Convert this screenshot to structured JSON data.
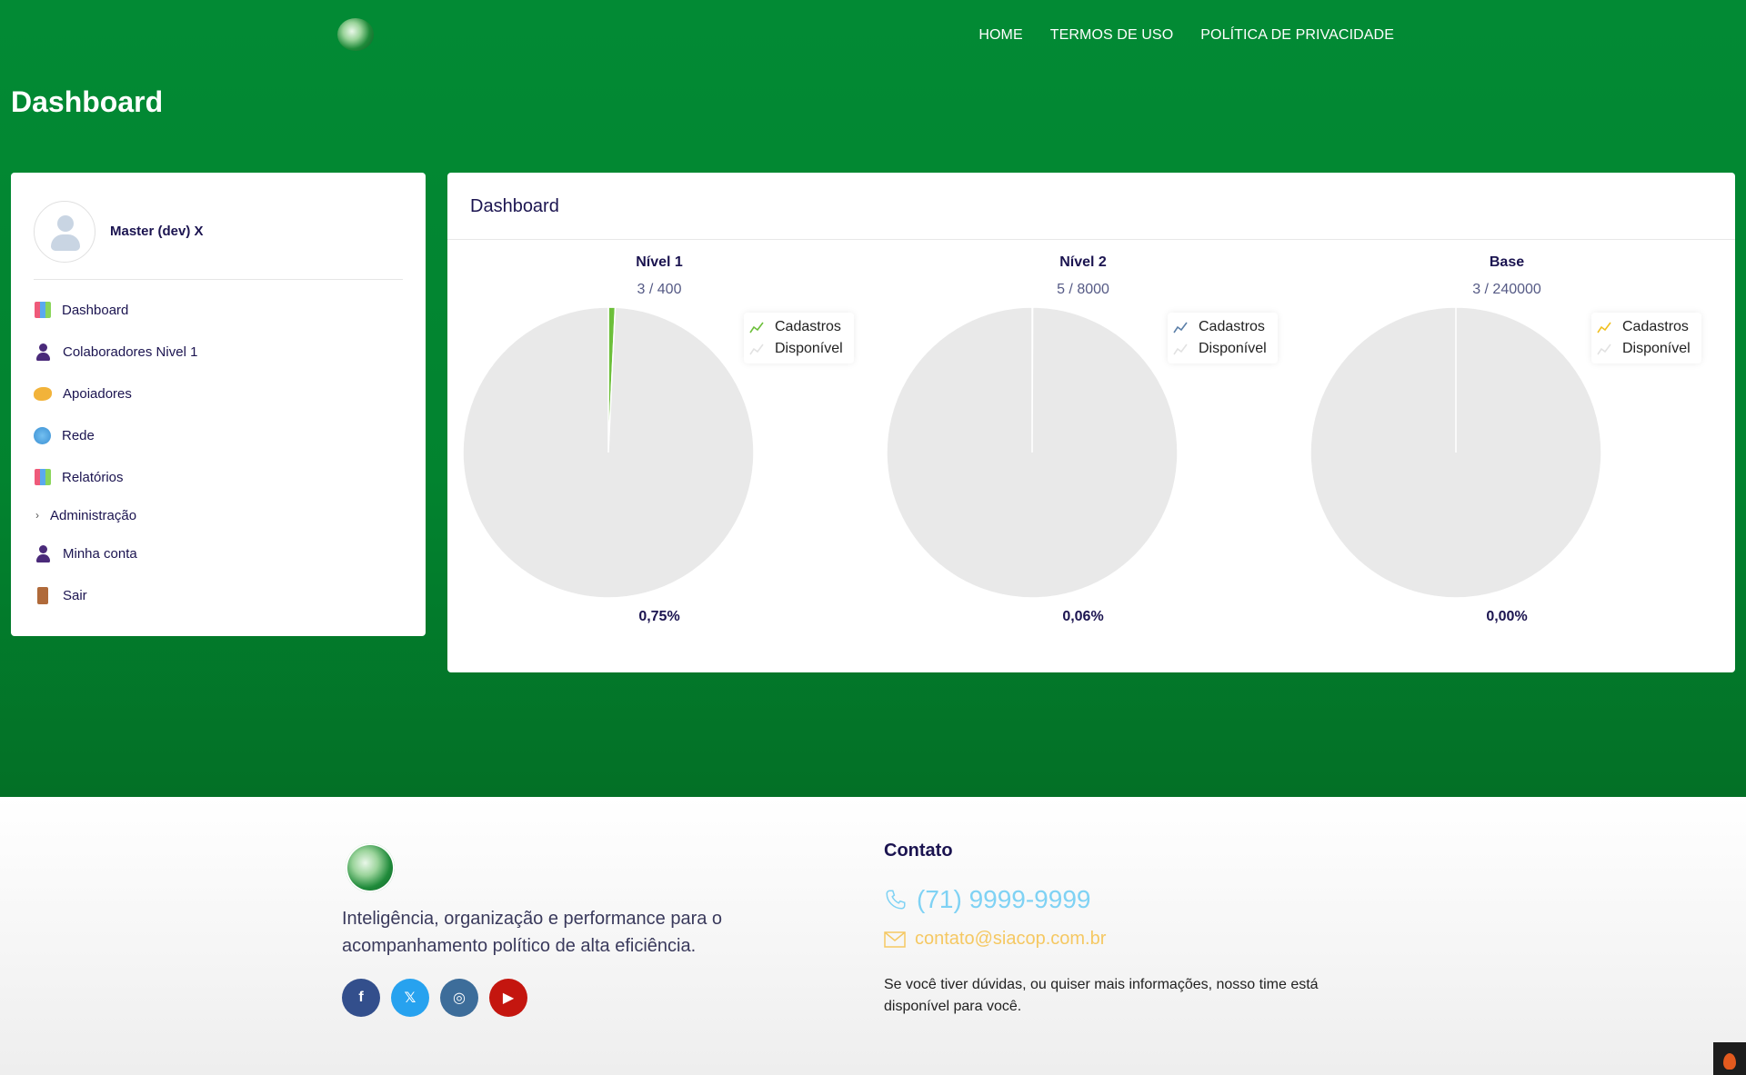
{
  "nav": {
    "items": [
      "HOME",
      "TERMOS DE USO",
      "POLÍTICA DE PRIVACIDADE"
    ]
  },
  "page_title": "Dashboard",
  "sidebar": {
    "user_name": "Master (dev) X",
    "items": [
      {
        "label": "Dashboard",
        "icon": "bar-chart-icon"
      },
      {
        "label": "Colaboradores Nivel 1",
        "icon": "user-icon"
      },
      {
        "label": "Apoiadores",
        "icon": "handshake-icon"
      },
      {
        "label": "Rede",
        "icon": "globe-icon"
      },
      {
        "label": "Relatórios",
        "icon": "bar-chart-icon"
      },
      {
        "label": "Administração",
        "icon": "chevron-right-icon"
      },
      {
        "label": "Minha conta",
        "icon": "user-icon"
      },
      {
        "label": "Sair",
        "icon": "door-icon"
      }
    ]
  },
  "main": {
    "title": "Dashboard"
  },
  "chart_data": [
    {
      "type": "pie",
      "title": "Nível 1",
      "subtitle": "3 / 400",
      "categories": [
        "Cadastros",
        "Disponível"
      ],
      "values": [
        3,
        397
      ],
      "percent_label": "0,75%",
      "colors": [
        "#6cbf3a",
        "#e9e9e9"
      ],
      "legend": "top-right"
    },
    {
      "type": "pie",
      "title": "Nível 2",
      "subtitle": "5 / 8000",
      "categories": [
        "Cadastros",
        "Disponível"
      ],
      "values": [
        5,
        7995
      ],
      "percent_label": "0,06%",
      "colors": [
        "#5b7fa8",
        "#e9e9e9"
      ],
      "legend": "top-right"
    },
    {
      "type": "pie",
      "title": "Base",
      "subtitle": "3 / 240000",
      "categories": [
        "Cadastros",
        "Disponível"
      ],
      "values": [
        3,
        239997
      ],
      "percent_label": "0,00%",
      "colors": [
        "#f0c020",
        "#e9e9e9"
      ],
      "legend": "top-right"
    }
  ],
  "footer": {
    "tagline": "Inteligência, organização e performance para o acompanhamento político de alta eficiência.",
    "social": [
      {
        "name": "facebook-icon",
        "glyph": "f"
      },
      {
        "name": "x-icon",
        "glyph": "𝕏"
      },
      {
        "name": "instagram-icon",
        "glyph": "◎"
      },
      {
        "name": "youtube-icon",
        "glyph": "▶"
      }
    ],
    "contact_heading": "Contato",
    "phone": "(71) 9999-9999",
    "email": "contato@siacop.com.br",
    "note": "Se você tiver dúvidas, ou quiser mais informações, nosso time está disponível para você."
  },
  "colors": {
    "brand_green": "#028a34",
    "text_dark": "#1b1450",
    "phone": "#7fd2f4",
    "email": "#f5c862"
  }
}
